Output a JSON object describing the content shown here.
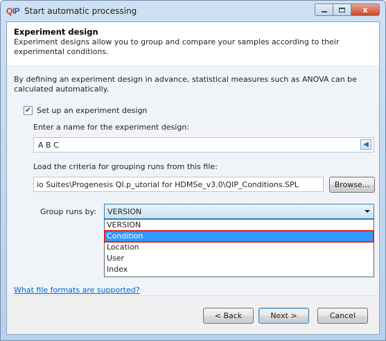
{
  "window": {
    "logo_q": "QI",
    "logo_p": "P",
    "title": "Start automatic processing",
    "close_glyph": "x"
  },
  "header": {
    "title": "Experiment design",
    "description": "Experiment designs allow you to group and compare your samples according to their experimental conditions."
  },
  "body": {
    "intro": "By defining an experiment design in advance, statistical measures such as ANOVA can be calculated automatically.",
    "setup_checkbox": {
      "label": "Set up an experiment design",
      "checked": true,
      "check_glyph": "✔"
    },
    "name_label": "Enter a name for the experiment design:",
    "name_value": "A B C",
    "name_arrow_glyph": "◀",
    "load_label": "Load the criteria for grouping runs from this file:",
    "path_value": "io Suites\\Progenesis QI.p_utorial for HDMSe_v3.0\\QIP_Conditions.SPL",
    "browse_label": "Browse...",
    "group_label": "Group runs by:",
    "group_selected": "VERSION",
    "group_options": [
      "VERSION",
      "Condition",
      "Location",
      "User",
      "Index"
    ],
    "highlighted_option": "Condition",
    "help_link": "What file formats are supported?"
  },
  "footer": {
    "back_label": "< Back",
    "next_label": "Next >",
    "cancel_label": "Cancel"
  }
}
